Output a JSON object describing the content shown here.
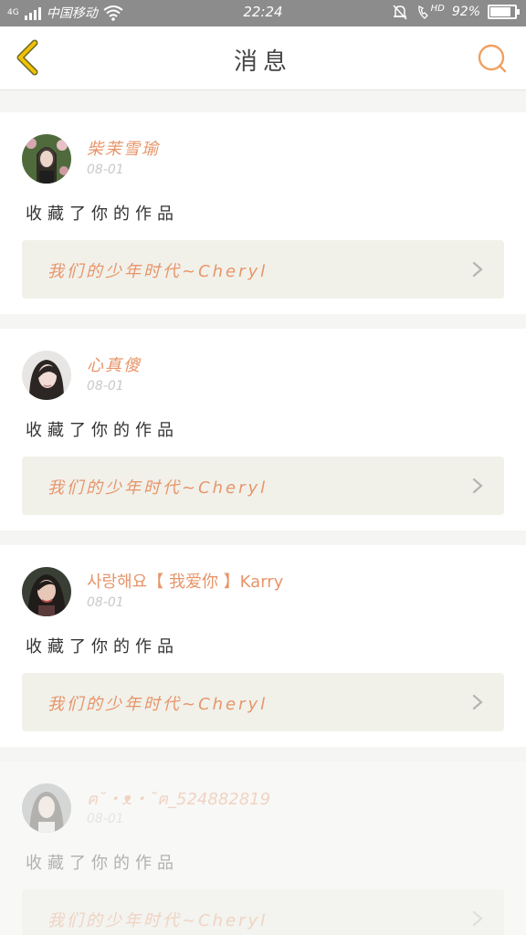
{
  "status_bar": {
    "network": "4G",
    "carrier": "中国移动",
    "time": "22:24",
    "hd": "HD",
    "battery": "92%",
    "battery_level": 0.92
  },
  "header": {
    "title": "消息",
    "back_icon": "chevron-left-icon",
    "search_icon": "search-icon"
  },
  "colors": {
    "accent": "#e7956a",
    "back_icon": "#f2c200",
    "search_icon": "#f0a060"
  },
  "messages": [
    {
      "username": "柴茉雪瑜",
      "date": "08-01",
      "action": "收藏了你的作品",
      "work_title": "我们的少年时代~Cheryl"
    },
    {
      "username": "心真傻",
      "date": "08-01",
      "action": "收藏了你的作品",
      "work_title": "我们的少年时代~Cheryl"
    },
    {
      "username": "사랑해요【 我爱你 】Karry",
      "date": "08-01",
      "action": "收藏了你的作品",
      "work_title": "我们的少年时代~Cheryl"
    },
    {
      "username": "ฅ˘・ᴥ・˘ฅ_524882819",
      "date": "08-01",
      "action": "收藏了你的作品",
      "work_title": "我们的少年时代~Cheryl"
    }
  ]
}
